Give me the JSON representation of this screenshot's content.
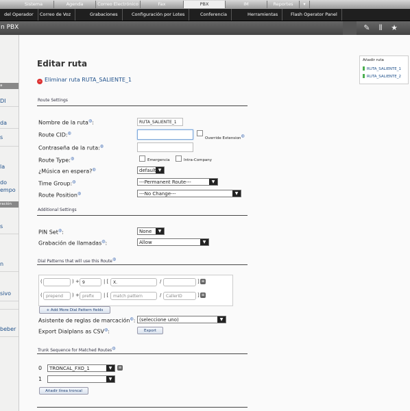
{
  "topnav": {
    "tabs": [
      "Sistema",
      "Agenda",
      "Correo Electrónico",
      "Fax",
      "PBX",
      "IM",
      "Reportes"
    ]
  },
  "subnav": {
    "items": [
      "del Operador",
      "Correo de Voz",
      "Grabaciones",
      "Configuración por Lotes",
      "Conferencia",
      "Herramientas",
      "Flash Operator Panel"
    ]
  },
  "titlebar": {
    "title": "n PBX"
  },
  "sidebar": {
    "items": [
      "DI",
      "da",
      "s",
      "la",
      "do",
      "empo",
      "s",
      "n",
      "sivo",
      "beber"
    ],
    "headers": [
      "a",
      "ración"
    ]
  },
  "page": {
    "title": "Editar ruta",
    "delete_link": "Eliminar ruta RUTA_SALIENTE_1"
  },
  "route_settings": {
    "section_title": "Route Settings",
    "route_name_label": "Nombre de la ruta",
    "route_name_value": "RUTA_SALIENTE_1",
    "route_cid_label": "Route CID:",
    "override_extension_label": "Override Extension",
    "password_label": "Contraseña de la ruta:",
    "route_type_label": "Route Type:",
    "route_type_emergency": "Emergencia",
    "route_type_intra": "Intra-Company",
    "music_label": "¿Música en espera?",
    "music_value": "default",
    "time_group_label": "Time Group:",
    "time_group_value": "---Permanent Route---",
    "route_position_label": "Route Position",
    "route_position_value": "---No Change---"
  },
  "additional_settings": {
    "section_title": "Additional Settings",
    "pin_set_label": "PIN Set",
    "pin_set_value": "None",
    "recording_label": "Grabación de llamadas",
    "recording_value": "Allow"
  },
  "dial_patterns": {
    "section_title": "Dial Patterns that will use this Route",
    "row1": {
      "prepend": "",
      "prefix": "9",
      "match": "X.",
      "callerid": ""
    },
    "row2": {
      "prepend": "prepend",
      "prefix": "prefix",
      "match": "match pattern",
      "callerid": "CallerID"
    },
    "add_more_button": "+ Add More Dial Pattern fields",
    "wizard_label": "Asistente de reglas de marcación",
    "wizard_value": "(seleccione uno)",
    "export_label": "Export Dialplans as CSV",
    "export_button": "Export"
  },
  "trunk_sequence": {
    "section_title": "Trunk Sequence for Matched Routes",
    "rows": [
      {
        "index": "0",
        "value": "TRONCAL_FXO_1"
      },
      {
        "index": "1",
        "value": ""
      }
    ],
    "add_trunk_button": "Añadir línea troncal"
  },
  "right_nav": {
    "title": "Añadir ruta",
    "items": [
      "RUTA_SALIENTE_1",
      "RUTA_SALIENTE_2"
    ]
  }
}
